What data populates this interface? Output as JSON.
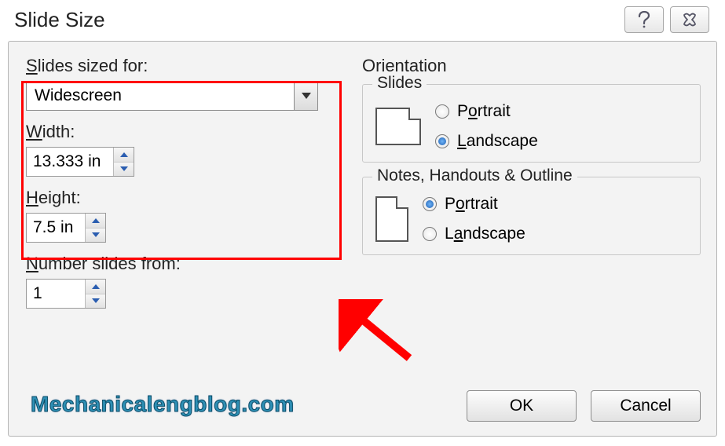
{
  "dialog": {
    "title": "Slide Size",
    "slides_sized_for_label": "Slides sized for:",
    "slides_sized_for_value": "Widescreen",
    "width_label": "Width:",
    "width_value": "13.333 in",
    "height_label": "Height:",
    "height_value": "7.5 in",
    "number_from_label": "Number slides from:",
    "number_from_value": "1",
    "orientation_label": "Orientation",
    "group_slides_title": "Slides",
    "group_notes_title": "Notes, Handouts & Outline",
    "portrait_label": "Portrait",
    "landscape_label": "Landscape",
    "slides_selected": "landscape",
    "notes_selected": "portrait",
    "ok_label": "OK",
    "cancel_label": "Cancel"
  },
  "watermark": "Mechanicalengblog.com"
}
